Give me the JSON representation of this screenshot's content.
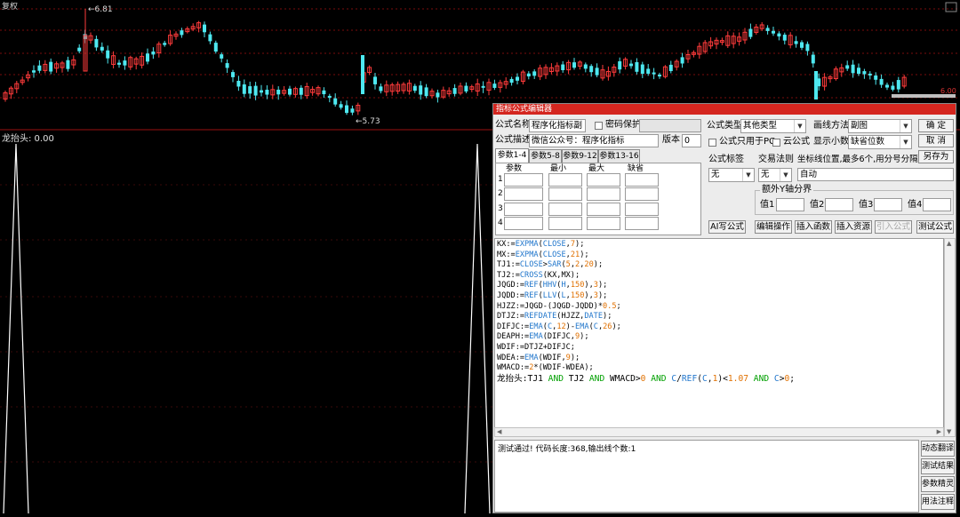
{
  "window_title": "复权",
  "price_high_label": "6.81",
  "price_low_label": "5.73",
  "axis_label": "6.00",
  "indicator_label": "龙抬头: 0.00",
  "dialog": {
    "title": "指标公式编辑器",
    "name_label": "公式名称",
    "name_value": "程序化指标副",
    "password_label": "密码保护",
    "desc_label": "公式描述",
    "desc_value": "微信公众号：程序化指标",
    "version_label": "版本",
    "version_value": "0",
    "type_label": "公式类型",
    "type_value": "其他类型",
    "draw_label": "画线方法",
    "draw_value": "副图",
    "pc_only_label": "公式只用于PC",
    "cloud_label": "云公式",
    "decimals_label": "显示小数",
    "decimals_value": "缺省位数",
    "ok_label": "确  定",
    "cancel_label": "取  消",
    "saveas_label": "另存为",
    "tabs": [
      "参数1-4",
      "参数5-8",
      "参数9-12",
      "参数13-16"
    ],
    "param_headers": [
      "参数",
      "最小",
      "最大",
      "缺省"
    ],
    "param_rows": [
      "1",
      "2",
      "3",
      "4"
    ],
    "tag_label": "公式标签",
    "tag_value": "无",
    "trade_label": "交易法则",
    "trade_value": "无",
    "coord_label": "坐标线位置,最多6个,用分号分隔",
    "coord_value": "自动",
    "yaxis_group": "额外Y轴分界",
    "yaxis_values": [
      "值1",
      "值2",
      "值3",
      "值4"
    ],
    "buttons": [
      "AI写公式",
      "编辑操作",
      "插入函数",
      "插入资源",
      "引入公式",
      "测试公式"
    ],
    "status_text": "测试通过! 代码长度:368,输出线个数:1",
    "side_buttons": [
      "动态翻译",
      "测试结果",
      "参数精灵",
      "用法注释"
    ]
  },
  "code_lines": [
    [
      [
        "KX:=",
        "k"
      ],
      [
        "EXPMA",
        "f"
      ],
      [
        "(",
        "k"
      ],
      [
        "CLOSE",
        "f"
      ],
      [
        ",",
        "k"
      ],
      [
        "7",
        "n"
      ],
      [
        ");",
        "k"
      ]
    ],
    [
      [
        "MX:=",
        "k"
      ],
      [
        "EXPMA",
        "f"
      ],
      [
        "(",
        "k"
      ],
      [
        "CLOSE",
        "f"
      ],
      [
        ",",
        "k"
      ],
      [
        "21",
        "n"
      ],
      [
        ");",
        "k"
      ]
    ],
    [
      [
        "TJ1:=",
        "k"
      ],
      [
        "CLOSE",
        "f"
      ],
      [
        ">",
        "k"
      ],
      [
        "SAR",
        "f"
      ],
      [
        "(",
        "k"
      ],
      [
        "5",
        "n"
      ],
      [
        ",",
        "k"
      ],
      [
        "2",
        "n"
      ],
      [
        ",",
        "k"
      ],
      [
        "20",
        "n"
      ],
      [
        ");",
        "k"
      ]
    ],
    [
      [
        "TJ2:=",
        "k"
      ],
      [
        "CROSS",
        "f"
      ],
      [
        "(KX,MX);",
        "k"
      ]
    ],
    [
      [
        "JQGD:=",
        "k"
      ],
      [
        "REF",
        "f"
      ],
      [
        "(",
        "k"
      ],
      [
        "HHV",
        "f"
      ],
      [
        "(",
        "k"
      ],
      [
        "H",
        "f"
      ],
      [
        ",",
        "k"
      ],
      [
        "150",
        "n"
      ],
      [
        "),",
        "k"
      ],
      [
        "3",
        "n"
      ],
      [
        ");",
        "k"
      ]
    ],
    [
      [
        "JQDD:=",
        "k"
      ],
      [
        "REF",
        "f"
      ],
      [
        "(",
        "k"
      ],
      [
        "LLV",
        "f"
      ],
      [
        "(",
        "k"
      ],
      [
        "L",
        "f"
      ],
      [
        ",",
        "k"
      ],
      [
        "150",
        "n"
      ],
      [
        "),",
        "k"
      ],
      [
        "3",
        "n"
      ],
      [
        ");",
        "k"
      ]
    ],
    [
      [
        "HJZZ:=JQGD-(JQGD-JQDD)*",
        "k"
      ],
      [
        "0.5",
        "n"
      ],
      [
        ";",
        "k"
      ]
    ],
    [
      [
        "DTJZ:=",
        "k"
      ],
      [
        "REFDATE",
        "f"
      ],
      [
        "(HJZZ,",
        "k"
      ],
      [
        "DATE",
        "f"
      ],
      [
        ");",
        "k"
      ]
    ],
    [
      [
        "DIFJC:=",
        "k"
      ],
      [
        "EMA",
        "f"
      ],
      [
        "(",
        "k"
      ],
      [
        "C",
        "f"
      ],
      [
        ",",
        "k"
      ],
      [
        "12",
        "n"
      ],
      [
        ")-",
        "k"
      ],
      [
        "EMA",
        "f"
      ],
      [
        "(",
        "k"
      ],
      [
        "C",
        "f"
      ],
      [
        ",",
        "k"
      ],
      [
        "26",
        "n"
      ],
      [
        ");",
        "k"
      ]
    ],
    [
      [
        "DEAPH:=",
        "k"
      ],
      [
        "EMA",
        "f"
      ],
      [
        "(DIFJC,",
        "k"
      ],
      [
        "9",
        "n"
      ],
      [
        ");",
        "k"
      ]
    ],
    [
      [
        "WDIF:=DTJZ+DIFJC;",
        "k"
      ]
    ],
    [
      [
        "WDEA:=",
        "k"
      ],
      [
        "EMA",
        "f"
      ],
      [
        "(WDIF,",
        "k"
      ],
      [
        "9",
        "n"
      ],
      [
        ");",
        "k"
      ]
    ],
    [
      [
        "WMACD:=",
        "k"
      ],
      [
        "2",
        "n"
      ],
      [
        "*(WDIF-WDEA);",
        "k"
      ]
    ],
    [
      [
        "龙抬头",
        "k"
      ],
      [
        ":TJ1 ",
        "k"
      ],
      [
        "AND",
        "g"
      ],
      [
        " TJ2 ",
        "k"
      ],
      [
        "AND",
        "g"
      ],
      [
        " WMACD>",
        "k"
      ],
      [
        "0",
        "n"
      ],
      [
        " ",
        "k"
      ],
      [
        "AND",
        "g"
      ],
      [
        " ",
        "k"
      ],
      [
        "C",
        "f"
      ],
      [
        "/",
        "k"
      ],
      [
        "REF",
        "f"
      ],
      [
        "(",
        "k"
      ],
      [
        "C",
        "f"
      ],
      [
        ",",
        "k"
      ],
      [
        "1",
        "n"
      ],
      [
        ")<",
        "k"
      ],
      [
        "1.07",
        "n"
      ],
      [
        " ",
        "k"
      ],
      [
        "AND",
        "g"
      ],
      [
        " ",
        "k"
      ],
      [
        "C",
        "f"
      ],
      [
        ">",
        "k"
      ],
      [
        "0",
        "n"
      ],
      [
        ";",
        "k"
      ]
    ]
  ],
  "colors": {
    "up": "#ff3b3b",
    "down": "#4ee8f0",
    "title_bar": "#d4261f",
    "code_func": "#2277cc",
    "code_num": "#e07000",
    "code_kw": "#00a000"
  }
}
